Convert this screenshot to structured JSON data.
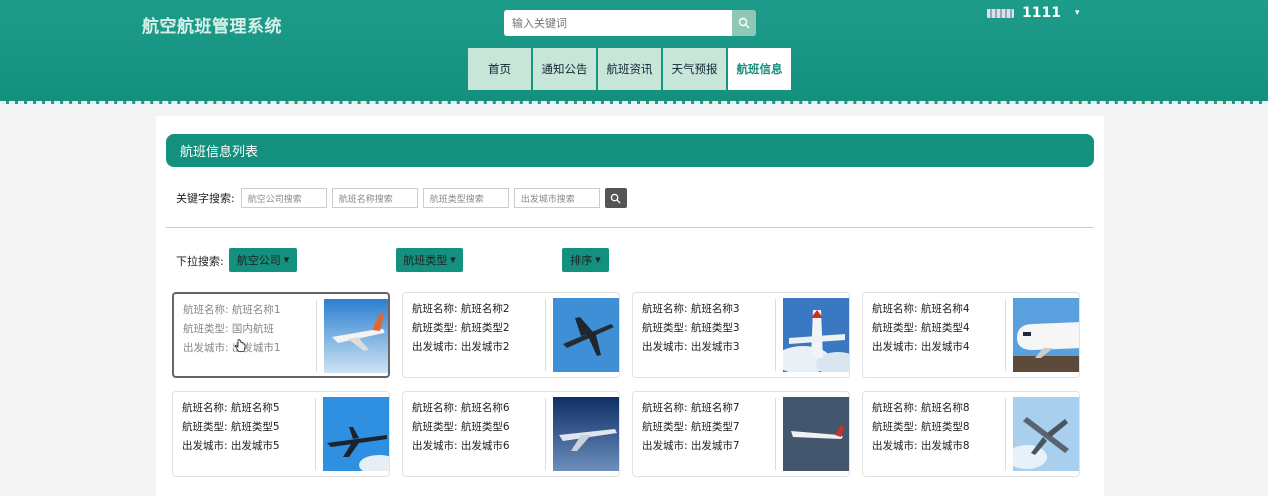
{
  "header": {
    "site_title": "航空航班管理系统",
    "search_placeholder": "输入关键词",
    "username": "1111"
  },
  "nav": {
    "tabs": [
      {
        "label": "首页",
        "active": false
      },
      {
        "label": "通知公告",
        "active": false
      },
      {
        "label": "航班资讯",
        "active": false
      },
      {
        "label": "天气预报",
        "active": false
      },
      {
        "label": "航班信息",
        "active": true
      }
    ]
  },
  "panel": {
    "title": "航班信息列表",
    "keyword_label": "关键字搜索:",
    "keyword_inputs": [
      "航空公司搜索",
      "航班名称搜索",
      "航班类型搜索",
      "出发城市搜索"
    ],
    "dropdown_label": "下拉搜索:",
    "dropdowns": [
      "航空公司",
      "航班类型",
      "排序"
    ]
  },
  "cards": [
    {
      "lines": [
        "航班名称: 航班名称1",
        "航班类型: 国内航班",
        "出发城市: 出发城市1"
      ],
      "thumb": "plane-orange-tail",
      "selected": true
    },
    {
      "lines": [
        "航班名称: 航班名称2",
        "航班类型: 航班类型2",
        "出发城市: 出发城市2"
      ],
      "thumb": "plane-blue-sky-top",
      "selected": false
    },
    {
      "lines": [
        "航班名称: 航班名称3",
        "航班类型: 航班类型3",
        "出发城市: 出发城市3"
      ],
      "thumb": "plane-clouds",
      "selected": false
    },
    {
      "lines": [
        "航班名称: 航班名称4",
        "航班类型: 航班类型4",
        "出发城市: 出发城市4"
      ],
      "thumb": "plane-nose-closeup",
      "selected": false
    },
    {
      "lines": [
        "航班名称: 航班名称5",
        "航班类型: 航班类型5",
        "出发城市: 出发城市5"
      ],
      "thumb": "plane-blue-sky",
      "selected": false
    },
    {
      "lines": [
        "航班名称: 航班名称6",
        "航班类型: 航班类型6",
        "出发城市: 出发城市6"
      ],
      "thumb": "plane-dusk",
      "selected": false
    },
    {
      "lines": [
        "航班名称: 航班名称7",
        "航班类型: 航班类型7",
        "出发城市: 出发城市7"
      ],
      "thumb": "plane-grey-sky",
      "selected": false
    },
    {
      "lines": [
        "航班名称: 航班名称8",
        "航班类型: 航班类型8",
        "出发城市: 出发城市8"
      ],
      "thumb": "plane-light-sky",
      "selected": false
    }
  ],
  "colors": {
    "brand": "#14907e",
    "nav_tab": "#c8e6d8",
    "search_btn": "#8fc7b6"
  }
}
